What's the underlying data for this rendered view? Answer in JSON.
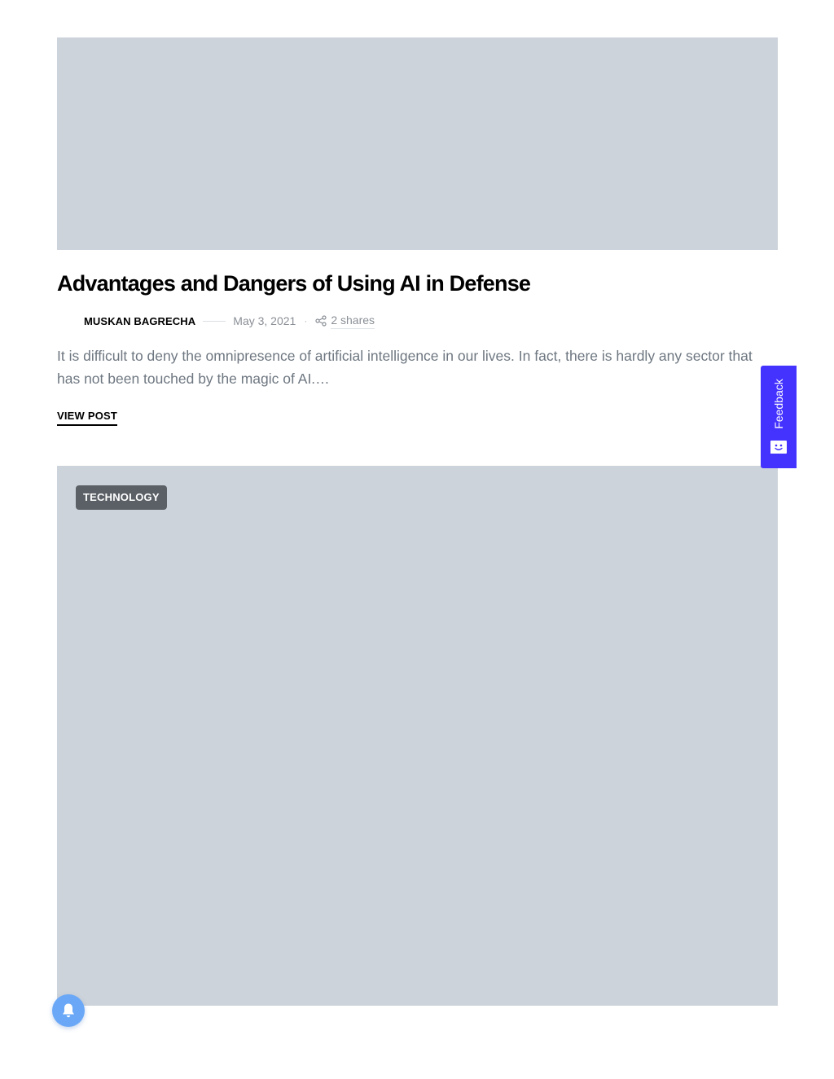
{
  "post": {
    "title": "Advantages and Dangers of Using AI in Defense",
    "author": "MUSKAN BAGRECHA",
    "date": "May 3, 2021",
    "separator": "·",
    "shares": "2 shares",
    "excerpt": "It is difficult to deny the omnipresence of artificial intelligence in our lives. In fact, there is hardly any sector that has not been touched by the magic of AI.…",
    "view_post_label": "VIEW POST"
  },
  "next_post": {
    "category": "TECHNOLOGY"
  },
  "feedback": {
    "label": "Feedback"
  },
  "colors": {
    "image_placeholder": "#cdd3da",
    "feedback_accent": "#4433ff",
    "notification_button": "#6aa8f7",
    "category_badge": "#5b6066"
  },
  "icons": {
    "share": "share-icon",
    "feedback": "feedback-face-icon",
    "notification": "bell-icon"
  }
}
